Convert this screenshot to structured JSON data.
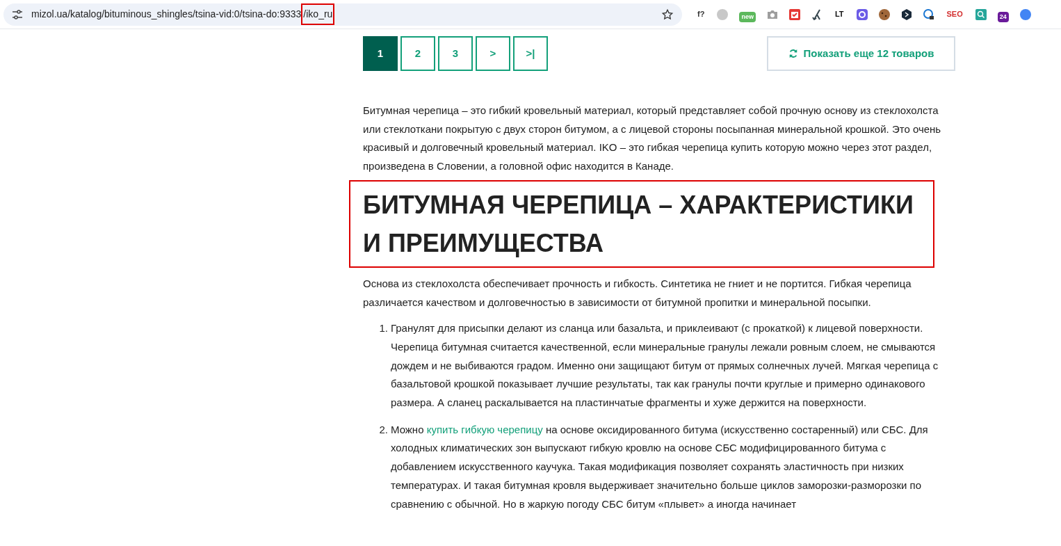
{
  "browser": {
    "url": "mizol.ua/katalog/bituminous_shingles/tsina-vid:0/tsina-do:9333",
    "url_highlight": "/iko_ru",
    "extensions": [
      {
        "kind": "text",
        "label": "f?",
        "color": "#333333"
      },
      {
        "kind": "circle",
        "color": "#c8c8c8"
      },
      {
        "kind": "badge",
        "badge": "new",
        "color": "#5cb85c"
      },
      {
        "kind": "camera",
        "color": "#9e9e9e"
      },
      {
        "kind": "check",
        "color": "#e53935"
      },
      {
        "kind": "fork",
        "color": "#37474f"
      },
      {
        "kind": "text",
        "label": "LT",
        "color": "#111111"
      },
      {
        "kind": "gear",
        "color": "#6c5ce7"
      },
      {
        "kind": "cookie",
        "color": "#a0673a"
      },
      {
        "kind": "hex",
        "color": "#1a2a3a"
      },
      {
        "kind": "lock",
        "color": "#1976d2"
      },
      {
        "kind": "text",
        "label": "SEO",
        "color": "#d32f2f"
      },
      {
        "kind": "search",
        "color": "#26a69a"
      },
      {
        "kind": "badge",
        "badge": "24",
        "color": "#6a1b9a"
      },
      {
        "kind": "circle",
        "color": "#4285f4"
      }
    ]
  },
  "pagination": [
    {
      "label": "1",
      "selected": true
    },
    {
      "label": "2",
      "selected": false
    },
    {
      "label": "3",
      "selected": false
    },
    {
      "label": ">",
      "selected": false
    },
    {
      "label": ">|",
      "selected": false
    }
  ],
  "show_more": "Показать еще 12 товаров",
  "intro": "Битумная черепица – это гибкий кровельный материал, который представляет собой прочную основу из стеклохолста или стеклоткани покрытую с двух сторон битумом, а с лицевой стороны посыпанная минеральной крошкой. Это очень красивый и долговечный кровельный материал. IKO – это гибкая черепица купить которую можно через этот раздел, произведена в Словении, а головной офис находится в Канаде.",
  "heading": "БИТУМНАЯ ЧЕРЕПИЦА – ХАРАКТЕРИСТИКИ И ПРЕИМУЩЕСТВА",
  "paragraph": "Основа из стеклохолста обеспечивает прочность и гибкость. Синтетика не гниет и не портится. Гибкая черепица различается качеством и долговечностью в зависимости от битумной пропитки и минеральной посыпки.",
  "list": [
    {
      "number": "1.",
      "text": "Гранулят для присыпки делают из сланца или базальта, и приклеивают (с прокаткой) к лицевой поверхности. Черепица битумная считается качественной, если минеральные гранулы лежали ровным слоем, не смываются дождем и не выбиваются градом. Именно они защищают битум от прямых солнечных лучей. Мягкая черепица с базальтовой крошкой показывает лучшие результаты, так как гранулы почти круглые и примерно одинакового размера. А сланец раскалывается на пластинчатые фрагменты и хуже держится на поверхности."
    },
    {
      "number": "2.",
      "before": "Можно ",
      "link": "купить гибкую черепицу",
      "text": " на основе оксидированного битума (искусственно состаренный) или СБС. Для холодных климатических зон выпускают гибкую кровлю на основе СБС модифицированного битума с добавлением искусственного каучука. Такая модификация позволяет сохранять эластичность при низких температурах. И такая битумная кровля выдерживает значительно больше циклов заморозки-разморозки по сравнению с обычной. Но в жаркую погоду СБС битум «плывет» а иногда начинает"
    }
  ]
}
